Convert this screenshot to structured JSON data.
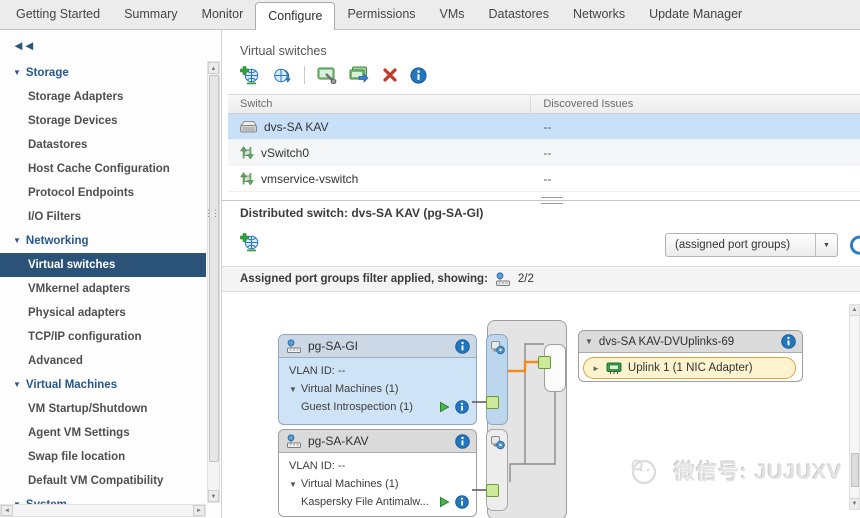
{
  "ui": {
    "caret_down": "▼",
    "caret_right": "►",
    "collapse_icon": "◄◄",
    "scroll_up": "▲",
    "scroll_down": "▼",
    "scroll_left": "◄",
    "scroll_right": "►",
    "side_grip": "⋮⋮"
  },
  "tabs": {
    "active": "Configure",
    "items": [
      {
        "label": "Getting Started"
      },
      {
        "label": "Summary"
      },
      {
        "label": "Monitor"
      },
      {
        "label": "Configure"
      },
      {
        "label": "Permissions"
      },
      {
        "label": "VMs"
      },
      {
        "label": "Datastores"
      },
      {
        "label": "Networks"
      },
      {
        "label": "Update Manager"
      }
    ]
  },
  "sidebar": {
    "items": [
      {
        "label": "Storage",
        "kind": "category"
      },
      {
        "label": "Storage Adapters"
      },
      {
        "label": "Storage Devices"
      },
      {
        "label": "Datastores"
      },
      {
        "label": "Host Cache Configuration"
      },
      {
        "label": "Protocol Endpoints"
      },
      {
        "label": "I/O Filters"
      },
      {
        "label": "Networking",
        "kind": "category"
      },
      {
        "label": "Virtual switches",
        "selected": true
      },
      {
        "label": "VMkernel adapters"
      },
      {
        "label": "Physical adapters"
      },
      {
        "label": "TCP/IP configuration"
      },
      {
        "label": "Advanced"
      },
      {
        "label": "Virtual Machines",
        "kind": "category"
      },
      {
        "label": "VM Startup/Shutdown"
      },
      {
        "label": "Agent VM Settings"
      },
      {
        "label": "Swap file location"
      },
      {
        "label": "Default VM Compatibility"
      },
      {
        "label": "System",
        "kind": "category"
      }
    ]
  },
  "main": {
    "title": "Virtual switches",
    "toolbar_icons": [
      "add-networking",
      "refresh-networking",
      "edit-settings",
      "migrate-vm-networking",
      "remove-switch",
      "switch-info"
    ],
    "table": {
      "columns": [
        "Switch",
        "Discovered Issues"
      ],
      "rows": [
        {
          "name": "dvs-SA KAV",
          "issues": "--",
          "icon": "distributed-switch",
          "selected": true
        },
        {
          "name": "vSwitch0",
          "issues": "--",
          "icon": "standard-switch"
        },
        {
          "name": "vmservice-vswitch",
          "issues": "--",
          "icon": "standard-switch"
        }
      ]
    },
    "detail": {
      "title": "Distributed switch: dvs-SA KAV (pg-SA-GI)",
      "dropdown_value": "(assigned port groups)",
      "filter_text": "Assigned port groups filter applied, showing:",
      "filter_count": "2/2"
    },
    "diagram": {
      "portgroups": [
        {
          "name": "pg-SA-GI",
          "vlan": "VLAN ID: --",
          "vms": "Virtual Machines (1)",
          "vm": "Guest Introspection (1)"
        },
        {
          "name": "pg-SA-KAV",
          "vlan": "VLAN ID: --",
          "vms": "Virtual Machines (1)",
          "vm": "Kaspersky File Antimalw..."
        }
      ],
      "uplinks": {
        "title": "dvs-SA KAV-DVUplinks-69",
        "item": "Uplink 1 (1 NIC Adapter)"
      }
    }
  },
  "watermark": {
    "text": "微信号: JUJUXV"
  },
  "colors": {
    "sidebar_selected": "#2b5277",
    "row_selected": "#c8e1f8",
    "accent_blue": "#2176bd",
    "link_orange": "#f08c1e",
    "uplink_border": "#dfa243",
    "uplink_bg": "#fdf4cf"
  }
}
